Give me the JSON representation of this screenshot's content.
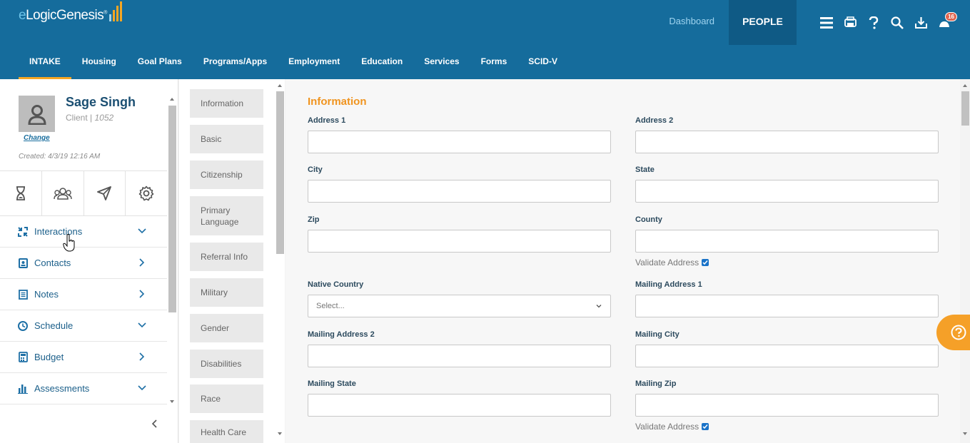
{
  "logo": {
    "text_e": "e",
    "text_rest": "LogicGenesis",
    "reg": "®"
  },
  "topnav": {
    "dashboard": "Dashboard",
    "people": "PEOPLE",
    "notification_count": "16"
  },
  "tabs": [
    "INTAKE",
    "Housing",
    "Goal Plans",
    "Programs/Apps",
    "Employment",
    "Education",
    "Services",
    "Forms",
    "SCID-V"
  ],
  "profile": {
    "name": "Sage Singh",
    "role": "Client |",
    "id": "1052",
    "change": "Change",
    "created": "Created: 4/3/19 12:16 AM"
  },
  "menu": [
    {
      "label": "Interactions",
      "icon": "interactions-icon",
      "chevron": "down"
    },
    {
      "label": "Contacts",
      "icon": "contacts-icon",
      "chevron": "right"
    },
    {
      "label": "Notes",
      "icon": "notes-icon",
      "chevron": "right"
    },
    {
      "label": "Schedule",
      "icon": "schedule-icon",
      "chevron": "down"
    },
    {
      "label": "Budget",
      "icon": "budget-icon",
      "chevron": "right"
    },
    {
      "label": "Assessments",
      "icon": "assessments-icon",
      "chevron": "down"
    }
  ],
  "sections": [
    "Information",
    "Basic",
    "Citizenship",
    "Primary Language",
    "Referral Info",
    "Military",
    "Gender",
    "Disabilities",
    "Race",
    "Health Care"
  ],
  "form": {
    "title": "Information",
    "address1": "Address 1",
    "address2": "Address 2",
    "city": "City",
    "state": "State",
    "zip": "Zip",
    "county": "County",
    "validate": "Validate Address",
    "native_country": "Native Country",
    "native_country_placeholder": "Select...",
    "mailing_address1": "Mailing Address 1",
    "mailing_address2": "Mailing Address 2",
    "mailing_city": "Mailing City",
    "mailing_state": "Mailing State",
    "mailing_zip": "Mailing Zip"
  },
  "colors": {
    "header": "#156c9c",
    "accent": "#f5a623",
    "title": "#f0941f"
  }
}
